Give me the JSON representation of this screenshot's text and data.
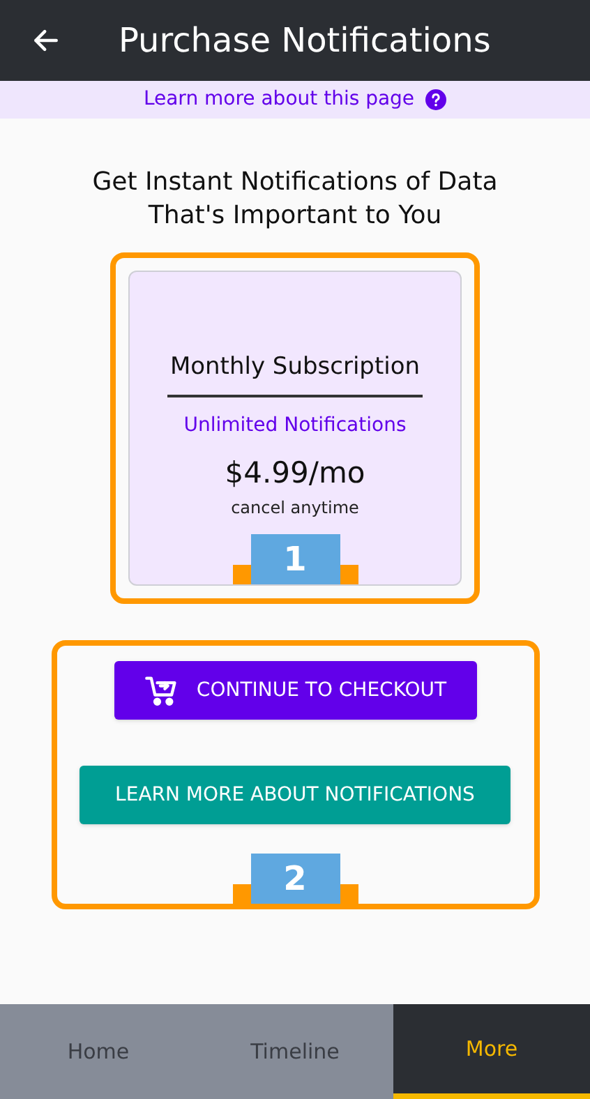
{
  "header": {
    "title": "Purchase Notifications"
  },
  "info_bar": {
    "link": "Learn more about this page"
  },
  "heading": "Get Instant Notifications of Data That's Important to You",
  "plan": {
    "title": "Monthly Subscription",
    "feature": "Unlimited Notifications",
    "price": "$4.99/mo",
    "note": "cancel anytime",
    "callout": "1"
  },
  "actions": {
    "buttons": [
      {
        "label": "CONTINUE TO CHECKOUT",
        "kind": "primary"
      },
      {
        "label": "LEARN MORE ABOUT NOTIFICATIONS",
        "kind": "secondary"
      }
    ],
    "callout": "2"
  },
  "tabs": [
    {
      "label": "Home",
      "selected": false
    },
    {
      "label": "Timeline",
      "selected": false
    },
    {
      "label": "More",
      "selected": true
    }
  ]
}
